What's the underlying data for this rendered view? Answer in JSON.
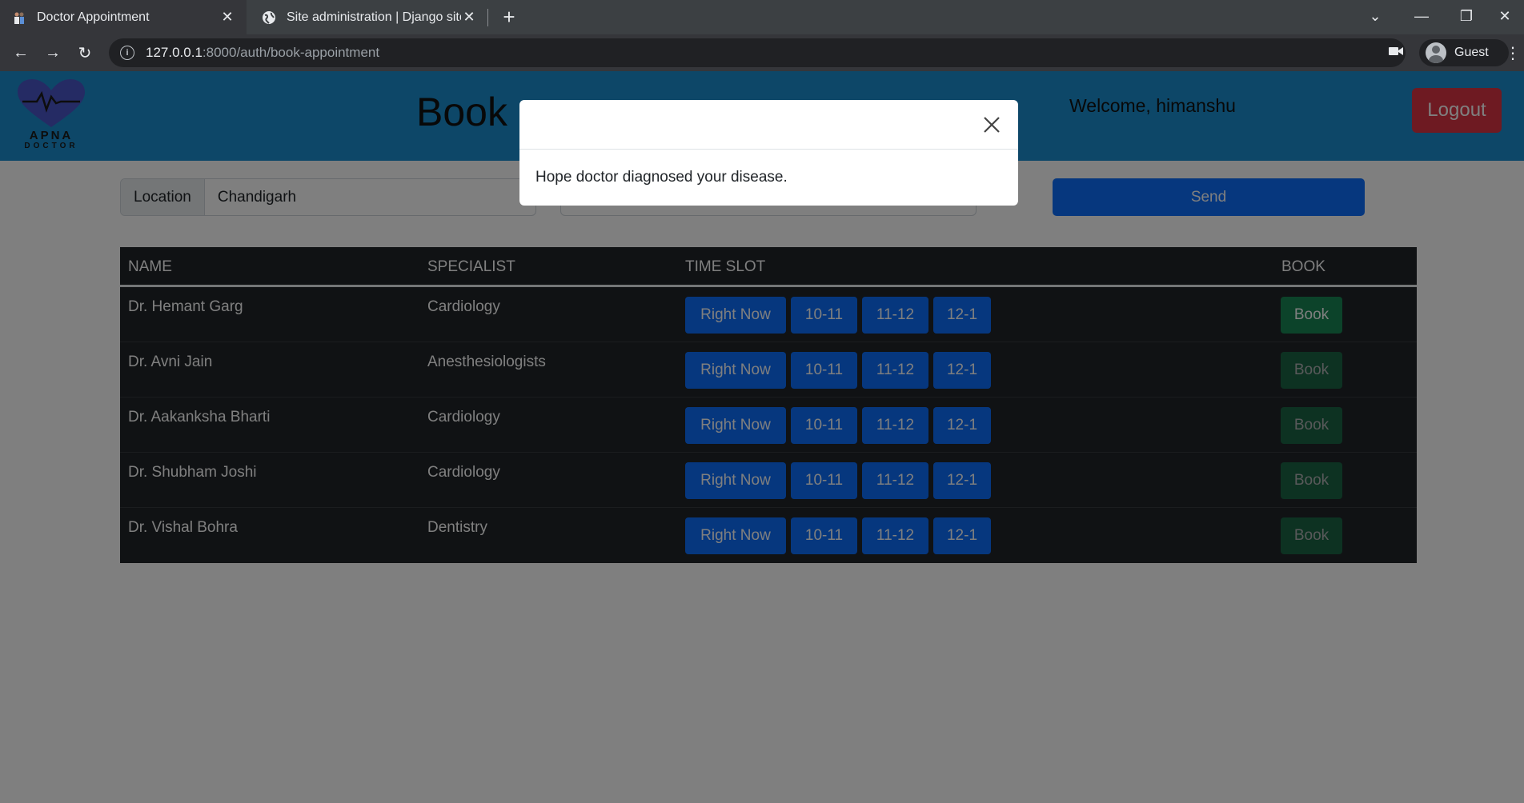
{
  "browser": {
    "tabs": [
      {
        "title": "Doctor Appointment",
        "active": true
      },
      {
        "title": "Site administration | Django site",
        "active": false
      }
    ],
    "url_host": "127.0.0.1",
    "url_path": ":8000/auth/book-appointment",
    "profile_label": "Guest"
  },
  "header": {
    "logo_line1": "APNA",
    "logo_line2": "DOCTOR",
    "title": "Book",
    "welcome": "Welcome, himanshu",
    "logout_label": "Logout"
  },
  "search": {
    "location_label": "Location",
    "location_value": "Chandigarh",
    "send_label": "Send"
  },
  "table": {
    "headers": {
      "name": "NAME",
      "specialist": "SPECIALIST",
      "time_slot": "TIME SLOT",
      "book": "BOOK"
    },
    "slots": [
      "Right Now",
      "10-11",
      "11-12",
      "12-1"
    ],
    "book_label": "Book",
    "rows": [
      {
        "name": "Dr. Hemant Garg",
        "specialist": "Cardiology"
      },
      {
        "name": "Dr. Avni Jain",
        "specialist": "Anesthesiologists"
      },
      {
        "name": "Dr. Aakanksha Bharti",
        "specialist": "Cardiology"
      },
      {
        "name": "Dr. Shubham Joshi",
        "specialist": "Cardiology"
      },
      {
        "name": "Dr. Vishal Bohra",
        "specialist": "Dentistry"
      }
    ]
  },
  "modal": {
    "message": "Hope doctor diagnosed your disease."
  },
  "colors": {
    "header_bg": "#1b8fd1",
    "primary": "#0d6efd",
    "success": "#198754",
    "danger": "#dc3545",
    "table_dark": "#212529"
  }
}
